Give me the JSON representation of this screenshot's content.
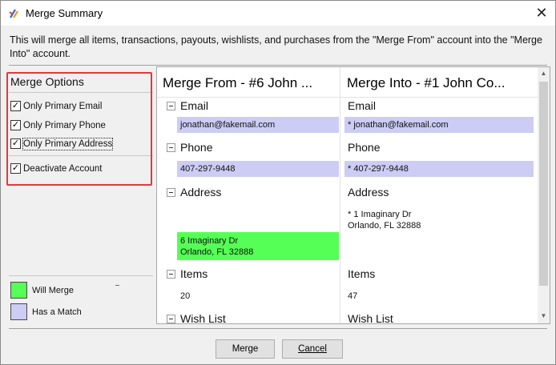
{
  "window": {
    "title": "Merge Summary",
    "close_glyph": "✕"
  },
  "description": "This will merge all items, transactions, payouts, wishlists, and purchases from the \"Merge From\" account into the \"Merge Into\" account.",
  "merge_options": {
    "title": "Merge Options",
    "checkboxes": [
      {
        "label": "Only Primary Email",
        "checked": true
      },
      {
        "label": "Only Primary Phone",
        "checked": true
      },
      {
        "label": "Only Primary Address",
        "checked": true
      },
      {
        "label": "Deactivate Account",
        "checked": true
      }
    ],
    "check_glyph": "✓"
  },
  "legend": [
    {
      "label": "Will Merge",
      "color": "#55ff55"
    },
    {
      "label": "Has a Match",
      "color": "#ccccf5"
    }
  ],
  "grid": {
    "from_header": "Merge From - #6 John ...",
    "into_header": "Merge Into - #1 John Co...",
    "sections": {
      "email": {
        "label_from": "Email",
        "label_into": "Email",
        "from_value": "jonathan@fakemail.com",
        "into_value": "* jonathan@fakemail.com"
      },
      "phone": {
        "label_from": "Phone",
        "label_into": "Phone",
        "from_value": "407-297-9448",
        "into_value": "* 407-297-9448"
      },
      "address": {
        "label_from": "Address",
        "label_into": "Address",
        "into_line1": "* 1 Imaginary Dr",
        "into_line2": "Orlando, FL  32888",
        "from_line1": "6 Imaginary Dr",
        "from_line2": "Orlando, FL  32888"
      },
      "items": {
        "label_from": "Items",
        "label_into": "Items",
        "from_value": "20",
        "into_value": "47"
      },
      "wishlist": {
        "label_from": "Wish List",
        "label_into": "Wish List"
      }
    }
  },
  "buttons": {
    "merge": "Merge",
    "cancel": "Cancel"
  },
  "colors": {
    "will_merge": "#55ff55",
    "has_match": "#ccccf5",
    "highlight_box": "#e0393e"
  }
}
